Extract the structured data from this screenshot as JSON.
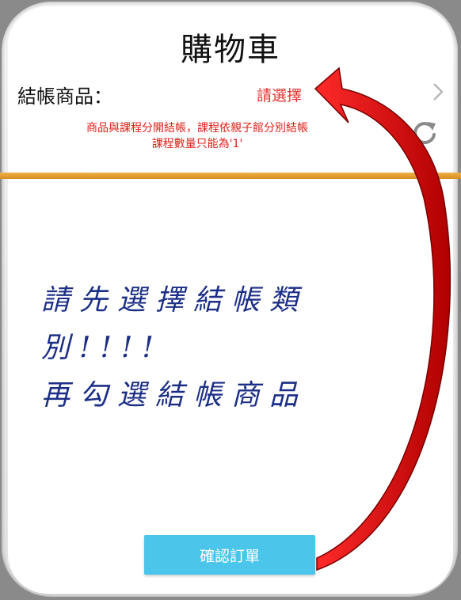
{
  "header": {
    "title": "購物車"
  },
  "checkout": {
    "label": "結帳商品：",
    "select_value": "請選擇",
    "select_icon": "chevron-right-icon",
    "refresh_icon": "refresh-icon",
    "notice_lines": [
      "商品與課程分開結帳，課程依親子館分別結帳",
      "課程數量只能為'1'"
    ],
    "select_color": "#e2342f",
    "notice_color": "#e0201a"
  },
  "annotation": {
    "lines": [
      "請先選擇結帳類別!!!!",
      "再勾選結帳商品"
    ],
    "color": "#1c2f86",
    "arrow_color": "#d40000"
  },
  "footer": {
    "confirm_label": "確認訂單",
    "confirm_color": "#4cc5ea"
  },
  "theme": {
    "divider_color": "#e19a2d"
  }
}
